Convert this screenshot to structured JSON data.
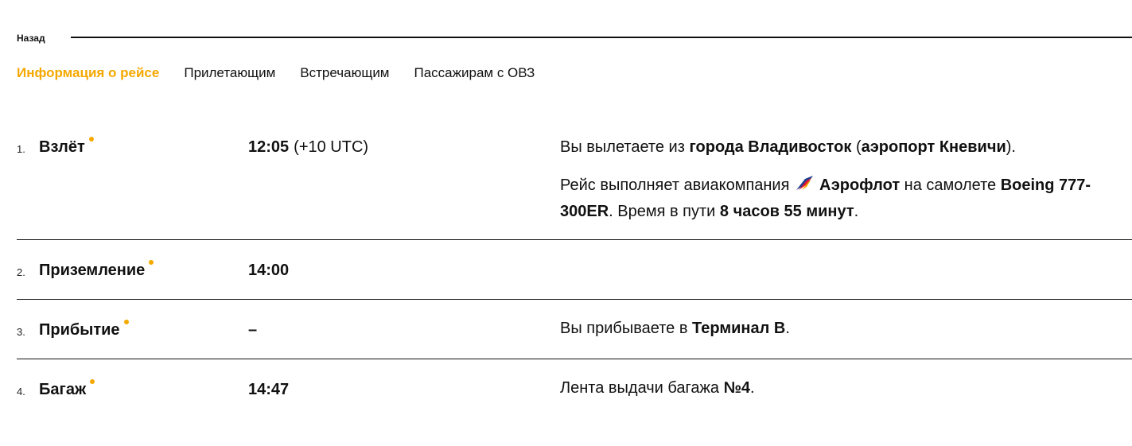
{
  "nav": {
    "back_label": "Назад"
  },
  "tabs": [
    {
      "label": "Информация о рейсе",
      "active": true
    },
    {
      "label": "Прилетающим",
      "active": false
    },
    {
      "label": "Встречающим",
      "active": false
    },
    {
      "label": "Пассажирам с ОВЗ",
      "active": false
    }
  ],
  "colors": {
    "accent": "#f5a800",
    "text": "#111111",
    "divider": "#111111"
  },
  "steps": [
    {
      "num": "1.",
      "title": "Взлёт",
      "time": "12:05",
      "tz": "(+10 UTC)",
      "info1": {
        "t1": "Вы вылетаете из ",
        "b1": "города Владивосток",
        "t2": " (",
        "b2": "аэропорт Кневичи",
        "t3": ")."
      },
      "info2": {
        "t1": "Рейс выполняет авиакомпания ",
        "airline_icon": "aeroflot-logo-icon",
        "b1": "Аэрофлот",
        "t2": " на самолете ",
        "b2": "Boeing 777-300ER",
        "t3": ". Время в пути ",
        "b3": "8 часов 55 минут",
        "t4": "."
      }
    },
    {
      "num": "2.",
      "title": "Приземление",
      "time": "14:00"
    },
    {
      "num": "3.",
      "title": "Прибытие",
      "time": "–",
      "info1": {
        "t1": "Вы прибываете в ",
        "b1": "Терминал B",
        "t2": "."
      }
    },
    {
      "num": "4.",
      "title": "Багаж",
      "time": "14:47",
      "info1": {
        "t1": "Лента выдачи багажа ",
        "b1": "№4",
        "t2": "."
      }
    }
  ]
}
